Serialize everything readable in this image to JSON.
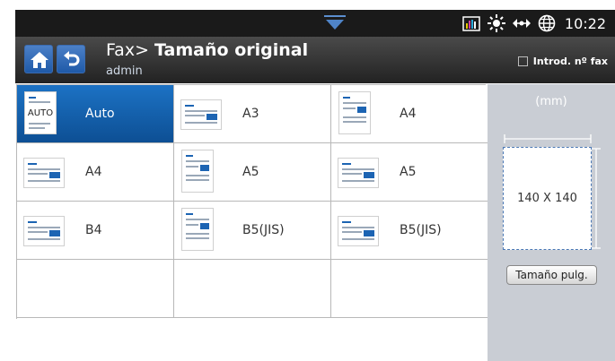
{
  "status": {
    "time": "10:22",
    "icons": [
      "toner-level-icon",
      "brightness-icon",
      "network-icon",
      "globe-icon"
    ]
  },
  "title_bar": {
    "prefix": "Fax>",
    "title": "Tamaño original",
    "user": "admin",
    "fax_number_label": "Introd. nº fax"
  },
  "sizes": [
    {
      "label": "Auto",
      "icon_text": "AUTO",
      "selected": true
    },
    {
      "label": "A3",
      "selected": false
    },
    {
      "label": "A4",
      "selected": false
    },
    {
      "label": "A4",
      "selected": false
    },
    {
      "label": "A5",
      "selected": false
    },
    {
      "label": "A5",
      "selected": false
    },
    {
      "label": "B4",
      "selected": false
    },
    {
      "label": "B5(JIS)",
      "selected": false
    },
    {
      "label": "B5(JIS)",
      "selected": false
    }
  ],
  "preview": {
    "unit": "(mm)",
    "dimensions": "140 X 140",
    "inch_button": "Tamaño pulg."
  },
  "colors": {
    "selected": "#0f5aa8",
    "accent": "#2d6ab8"
  }
}
